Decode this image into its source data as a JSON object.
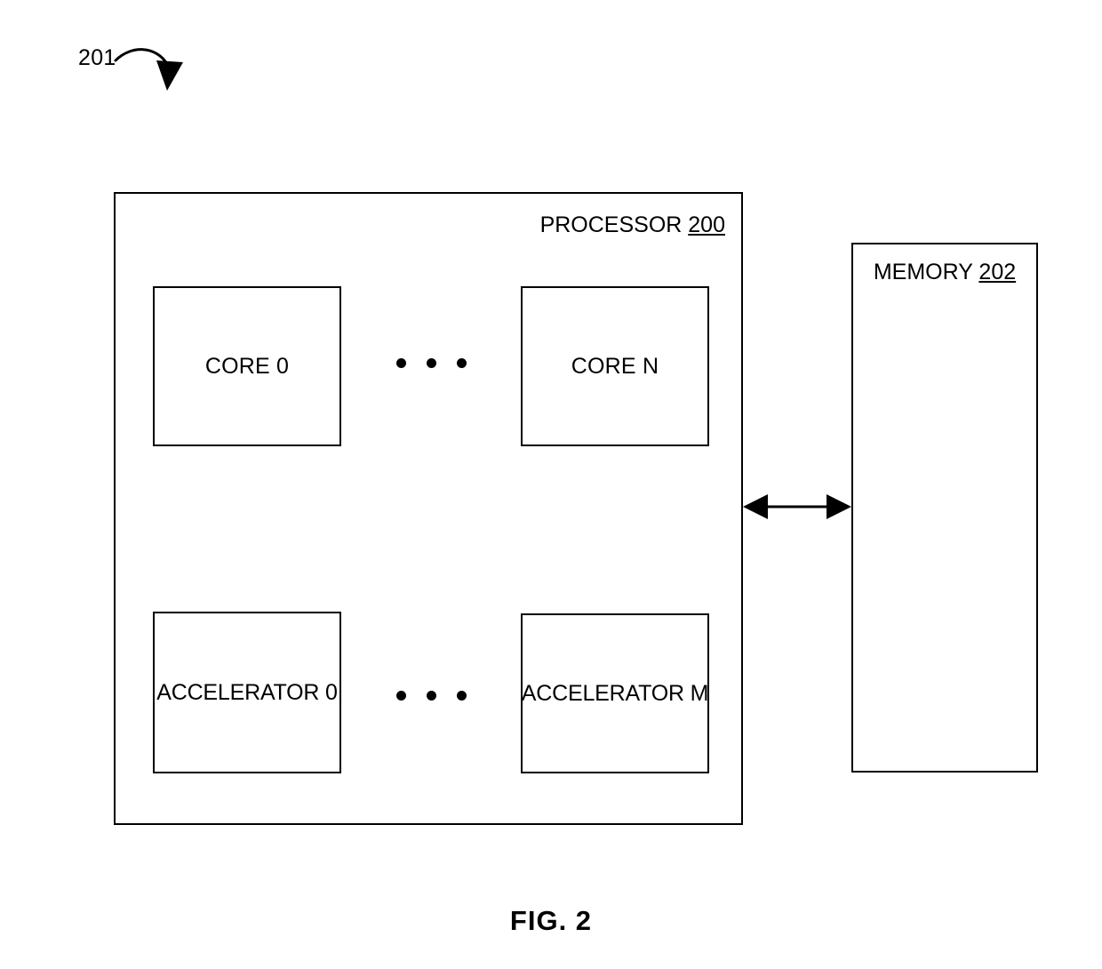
{
  "figure": {
    "caption": "FIG. 2",
    "callout_ref": "201"
  },
  "processor": {
    "title_text": "PROCESSOR",
    "title_number": "200",
    "cores": [
      {
        "label": "CORE 0",
        "name": "core-0"
      },
      {
        "label": "CORE N",
        "name": "core-n"
      }
    ],
    "accelerators": [
      {
        "label": "ACCELERATOR 0",
        "name": "accelerator-0"
      },
      {
        "label": "ACCELERATOR M",
        "name": "accelerator-m"
      }
    ],
    "ellipsis_dots": 3
  },
  "memory": {
    "title_text": "MEMORY",
    "title_number": "202"
  },
  "connector": {
    "type": "bidirectional-arrow",
    "from": "processor",
    "to": "memory"
  },
  "colors": {
    "stroke": "#000000",
    "fill": "#ffffff"
  }
}
